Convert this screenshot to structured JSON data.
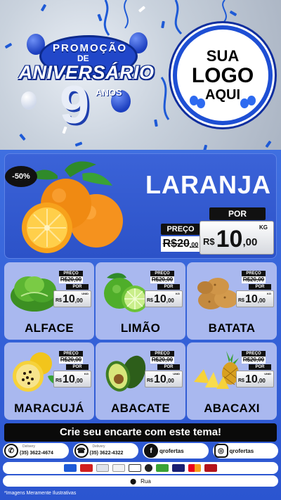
{
  "hero": {
    "promo_word": "PROMOÇÃO",
    "de": "DE",
    "aniversario": "ANIVERSÁRIO",
    "number": "9",
    "anos": "ANOS",
    "logo_line1": "SUA",
    "logo_line2": "LOGO",
    "logo_line3": "AQUI"
  },
  "featured": {
    "badge": "-50%",
    "name": "LARANJA",
    "preco_label": "PREÇO",
    "por_label": "POR",
    "old_price_int": "R$20",
    "old_price_dec": ",00",
    "currency": "R$",
    "price_int": "10",
    "price_dec": ",00",
    "unit": "KG",
    "icon": "orange-icon"
  },
  "products": [
    {
      "name": "ALFACE",
      "preco": "PREÇO",
      "old": "R$20,00",
      "por": "POR",
      "currency": "R$",
      "int": "10",
      "dec": ",00",
      "unit": "UNID",
      "icon": "lettuce-icon"
    },
    {
      "name": "LIMÃO",
      "preco": "PREÇO",
      "old": "R$20,00",
      "por": "POR",
      "currency": "R$",
      "int": "10",
      "dec": ",00",
      "unit": "KG",
      "icon": "lime-icon"
    },
    {
      "name": "BATATA",
      "preco": "PREÇO",
      "old": "R$20,00",
      "por": "POR",
      "currency": "R$",
      "int": "10",
      "dec": ",00",
      "unit": "KG",
      "icon": "potato-icon"
    },
    {
      "name": "MARACUJÁ",
      "preco": "PREÇO",
      "old": "R$20,00",
      "por": "POR",
      "currency": "R$",
      "int": "10",
      "dec": ",00",
      "unit": "KG",
      "icon": "passionfruit-icon"
    },
    {
      "name": "ABACATE",
      "preco": "PREÇO",
      "old": "R$20,00",
      "por": "POR",
      "currency": "R$",
      "int": "10",
      "dec": ",00",
      "unit": "UNID",
      "icon": "avocado-icon"
    },
    {
      "name": "ABACAXI",
      "preco": "PREÇO",
      "old": "R$20,00",
      "por": "POR",
      "currency": "R$",
      "int": "10",
      "dec": ",00",
      "unit": "UNID",
      "icon": "pineapple-icon"
    }
  ],
  "banner": "Crie seu encarte com este tema!",
  "contacts": {
    "whatsapp_caption": "Delivery",
    "whatsapp": "(35) 3622-4674",
    "phone_caption": "Delivery",
    "phone": "(35) 3622-4322",
    "facebook": "qrofertas",
    "instagram": "qrofertas"
  },
  "payment_icons": [
    "card-icon",
    "card-icon",
    "card-icon",
    "card-icon",
    "card-icon",
    "card-icon",
    "card-icon",
    "visa-icon",
    "mastercard-icon",
    "hipercard-icon"
  ],
  "address": "Rua",
  "disclaimer": "*Imagens Meramente Ilustrativas",
  "colors": {
    "primary": "#2b55d0",
    "card": "#a9b8ef",
    "dark": "#0a0a0a"
  }
}
